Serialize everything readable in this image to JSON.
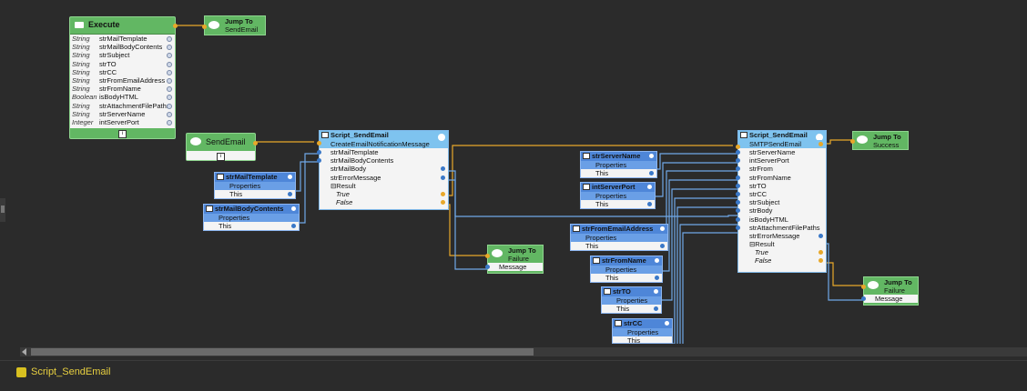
{
  "execute": {
    "title": "Execute",
    "params": [
      {
        "type": "String",
        "name": "strMailTemplate"
      },
      {
        "type": "String",
        "name": "strMailBodyContents"
      },
      {
        "type": "String",
        "name": "strSubject"
      },
      {
        "type": "String",
        "name": "strTO"
      },
      {
        "type": "String",
        "name": "strCC"
      },
      {
        "type": "String",
        "name": "strFromEmailAddress"
      },
      {
        "type": "String",
        "name": "strFromName"
      },
      {
        "type": "Boolean",
        "name": "isBodyHTML"
      },
      {
        "type": "String",
        "name": "strAttachmentFilePaths"
      },
      {
        "type": "String",
        "name": "strServerName"
      },
      {
        "type": "Integer",
        "name": "intServerPort"
      }
    ]
  },
  "jump_send": {
    "title": "Jump To",
    "target": "SendEmail"
  },
  "send_label": {
    "title": "SendEmail"
  },
  "script1": {
    "title": "Script_SendEmail",
    "method": "CreateEmailNotificationMessage",
    "inputs": [
      "strMailTemplate",
      "strMailBodyContents",
      "strMailBody",
      "strErrorMessage"
    ],
    "result": "Result",
    "true_label": "True",
    "false_label": "False"
  },
  "prop_mailtemplate": {
    "title": "strMailTemplate",
    "properties": "Properties",
    "this": "This"
  },
  "prop_mailbody": {
    "title": "strMailBodyContents",
    "properties": "Properties",
    "this": "This"
  },
  "jump_failure1": {
    "title": "Jump To",
    "target": "Failure",
    "message": "Message"
  },
  "prop_servername": {
    "title": "strServerName",
    "properties": "Properties",
    "this": "This"
  },
  "prop_serverport": {
    "title": "intServerPort",
    "properties": "Properties",
    "this": "This"
  },
  "prop_fromemail": {
    "title": "strFromEmailAddress",
    "properties": "Properties",
    "this": "This"
  },
  "prop_fromname": {
    "title": "strFromName",
    "properties": "Properties",
    "this": "This"
  },
  "prop_to": {
    "title": "strTO",
    "properties": "Properties",
    "this": "This"
  },
  "prop_cc": {
    "title": "strCC",
    "properties": "Properties",
    "this": "This"
  },
  "script2": {
    "title": "Script_SendEmail",
    "method": "SMTPSendEmail",
    "inputs": [
      "strServerName",
      "intServerPort",
      "strFrom",
      "strFromName",
      "strTO",
      "strCC",
      "strSubject",
      "strBody",
      "isBodyHTML",
      "strAttachmentFilePaths",
      "strErrorMessage"
    ],
    "result": "Result",
    "true_label": "True",
    "false_label": "False"
  },
  "jump_success": {
    "title": "Jump To",
    "target": "Success"
  },
  "jump_failure2": {
    "title": "Jump To",
    "target": "Failure",
    "message": "Message"
  },
  "tab": {
    "label": "Script_SendEmail"
  },
  "colors": {
    "green": "#62b763",
    "blue": "#4e86d8",
    "script_header": "#7ec3ef",
    "wire_yellow": "#e8a82a",
    "wire_blue": "#6fa8e8",
    "tab_text": "#e8d040"
  }
}
